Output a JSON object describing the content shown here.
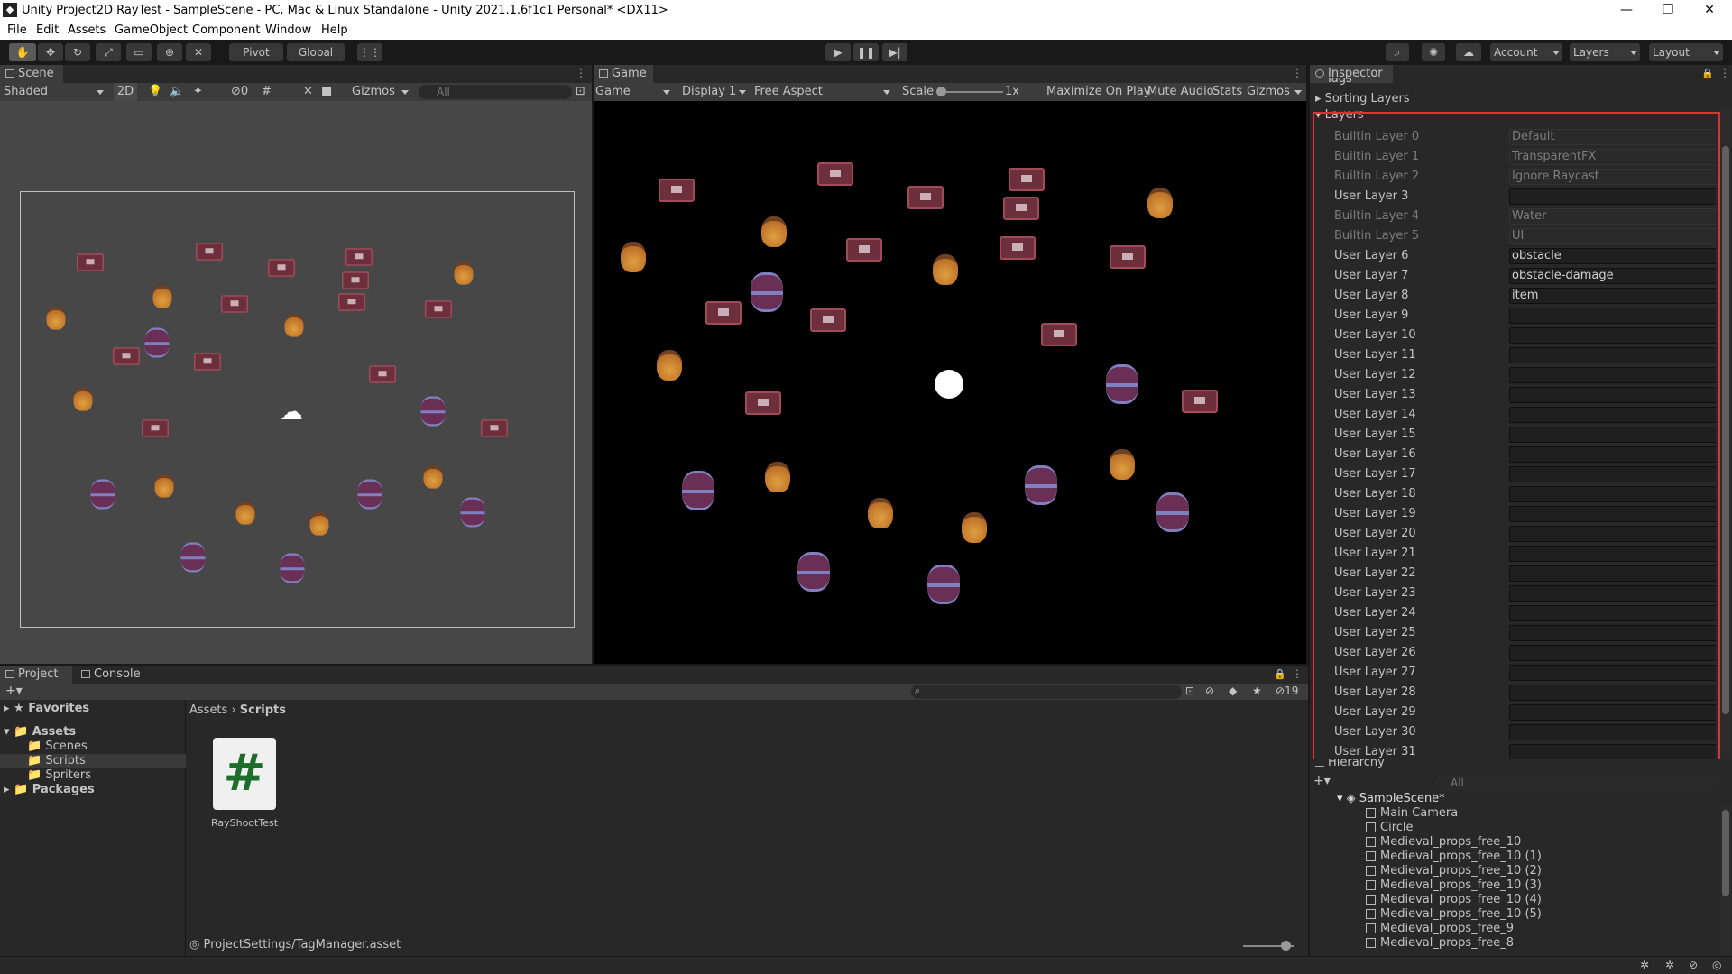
{
  "window": {
    "title": "Unity Project2D RayTest - SampleScene - PC, Mac & Linux Standalone - Unity 2021.1.6f1c1 Personal* <DX11>"
  },
  "menu": [
    "File",
    "Edit",
    "Assets",
    "GameObject",
    "Component",
    "Window",
    "Help"
  ],
  "toolbar": {
    "pivot": "Pivot",
    "global": "Global",
    "account": "Account",
    "layers": "Layers",
    "layout": "Layout"
  },
  "scene": {
    "tab": "Scene",
    "shading": "Shaded",
    "mode2d": "2D",
    "hidden_count": "0",
    "gizmos": "Gizmos",
    "search_placeholder": "All"
  },
  "game": {
    "tab": "Game",
    "display_mode": "Game",
    "display": "Display 1",
    "aspect": "Free Aspect",
    "scale_label": "Scale",
    "scale_value": "1x",
    "maximize": "Maximize On Play",
    "mute": "Mute Audio",
    "stats": "Stats",
    "gizmos": "Gizmos"
  },
  "inspector": {
    "tab": "Inspector",
    "tags": "Tags",
    "sorting_layers": "Sorting Layers",
    "layers_header": "Layers",
    "layers": [
      {
        "label": "Builtin Layer 0",
        "value": "Default",
        "builtin": true
      },
      {
        "label": "Builtin Layer 1",
        "value": "TransparentFX",
        "builtin": true
      },
      {
        "label": "Builtin Layer 2",
        "value": "Ignore Raycast",
        "builtin": true
      },
      {
        "label": "User Layer 3",
        "value": "",
        "builtin": false
      },
      {
        "label": "Builtin Layer 4",
        "value": "Water",
        "builtin": true
      },
      {
        "label": "Builtin Layer 5",
        "value": "UI",
        "builtin": true
      },
      {
        "label": "User Layer 6",
        "value": "obstacle",
        "builtin": false
      },
      {
        "label": "User Layer 7",
        "value": "obstacle-damage",
        "builtin": false
      },
      {
        "label": "User Layer 8",
        "value": "item",
        "builtin": false
      },
      {
        "label": "User Layer 9",
        "value": "",
        "builtin": false
      },
      {
        "label": "User Layer 10",
        "value": "",
        "builtin": false
      },
      {
        "label": "User Layer 11",
        "value": "",
        "builtin": false
      },
      {
        "label": "User Layer 12",
        "value": "",
        "builtin": false
      },
      {
        "label": "User Layer 13",
        "value": "",
        "builtin": false
      },
      {
        "label": "User Layer 14",
        "value": "",
        "builtin": false
      },
      {
        "label": "User Layer 15",
        "value": "",
        "builtin": false
      },
      {
        "label": "User Layer 16",
        "value": "",
        "builtin": false
      },
      {
        "label": "User Layer 17",
        "value": "",
        "builtin": false
      },
      {
        "label": "User Layer 18",
        "value": "",
        "builtin": false
      },
      {
        "label": "User Layer 19",
        "value": "",
        "builtin": false
      },
      {
        "label": "User Layer 20",
        "value": "",
        "builtin": false
      },
      {
        "label": "User Layer 21",
        "value": "",
        "builtin": false
      },
      {
        "label": "User Layer 22",
        "value": "",
        "builtin": false
      },
      {
        "label": "User Layer 23",
        "value": "",
        "builtin": false
      },
      {
        "label": "User Layer 24",
        "value": "",
        "builtin": false
      },
      {
        "label": "User Layer 25",
        "value": "",
        "builtin": false
      },
      {
        "label": "User Layer 26",
        "value": "",
        "builtin": false
      },
      {
        "label": "User Layer 27",
        "value": "",
        "builtin": false
      },
      {
        "label": "User Layer 28",
        "value": "",
        "builtin": false
      },
      {
        "label": "User Layer 29",
        "value": "",
        "builtin": false
      },
      {
        "label": "User Layer 30",
        "value": "",
        "builtin": false
      },
      {
        "label": "User Layer 31",
        "value": "",
        "builtin": false
      }
    ]
  },
  "hierarchy": {
    "tab": "Hierarchy",
    "search_placeholder": "All",
    "scene": "SampleScene*",
    "items": [
      "Main Camera",
      "Circle",
      "Medieval_props_free_10",
      "Medieval_props_free_10 (1)",
      "Medieval_props_free_10 (2)",
      "Medieval_props_free_10 (3)",
      "Medieval_props_free_10 (4)",
      "Medieval_props_free_10 (5)",
      "Medieval_props_free_9",
      "Medieval_props_free_8"
    ]
  },
  "project": {
    "tab_project": "Project",
    "tab_console": "Console",
    "favorites": "Favorites",
    "assets": "Assets",
    "folders": [
      "Scenes",
      "Scripts",
      "Spriters"
    ],
    "packages": "Packages",
    "breadcrumb_root": "Assets",
    "breadcrumb_current": "Scripts",
    "file_name": "RayShootTest",
    "file_icon": "#",
    "hidden_count": "19",
    "footer_path": "ProjectSettings/TagManager.asset"
  }
}
